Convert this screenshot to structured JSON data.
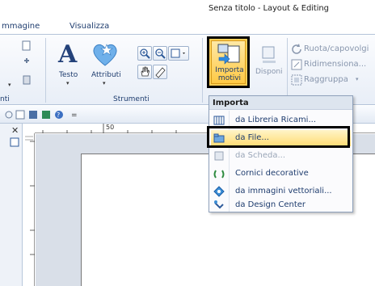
{
  "window": {
    "title": "Senza titolo - Layout & Editing"
  },
  "tabs": [
    {
      "label": "mmagine"
    },
    {
      "label": "Visualizza"
    }
  ],
  "ribbon": {
    "testo_label": "Testo",
    "attributi_label": "Attributi",
    "importa_label_1": "Importa",
    "importa_label_2": "motivi",
    "disponi_label": "Disponi",
    "ruota_label": "Ruota/capovolgi",
    "ridimensiona_label": "Ridimensiona...",
    "raggruppa_label": "Raggruppa",
    "group_left_label": "nti",
    "group_strumenti_label": "Strumenti"
  },
  "ruler": {
    "mark_50": "50"
  },
  "menu": {
    "header": "Importa",
    "items": [
      {
        "label": "da Libreria Ricami...",
        "icon": "library-icon",
        "enabled": true,
        "highlighted": false
      },
      {
        "label": "da File...",
        "icon": "folder-icon",
        "enabled": true,
        "highlighted": true
      },
      {
        "label": "da Scheda...",
        "icon": "card-icon",
        "enabled": false,
        "highlighted": false
      },
      {
        "label": "Cornici decorative",
        "icon": "frame-icon",
        "enabled": true,
        "highlighted": false
      },
      {
        "label": "da immagini vettoriali...",
        "icon": "vector-icon",
        "enabled": true,
        "highlighted": false
      },
      {
        "label": "da Design Center",
        "icon": "design-center-icon",
        "enabled": true,
        "highlighted": false
      }
    ]
  }
}
